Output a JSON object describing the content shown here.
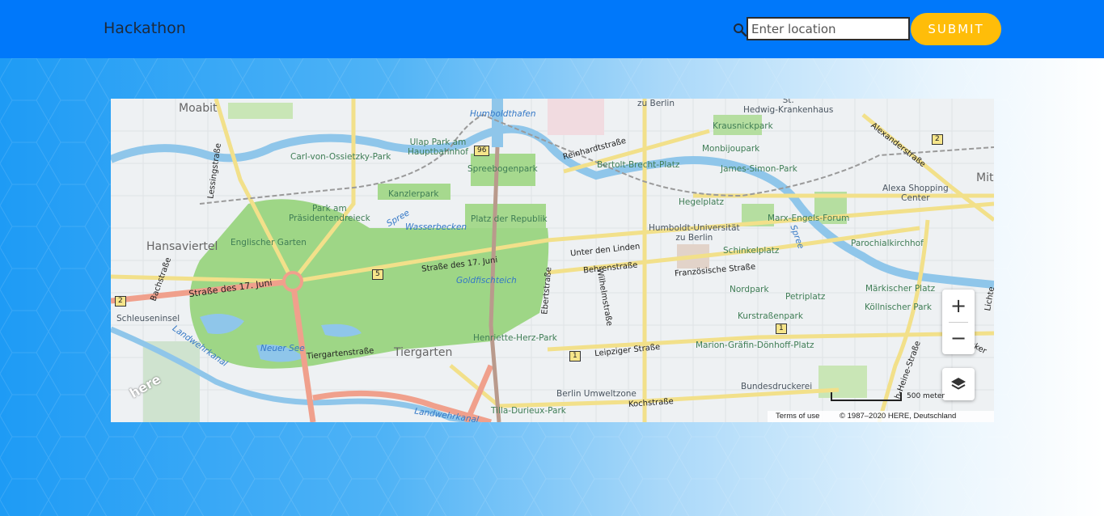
{
  "header": {
    "brand": "Hackathon",
    "search_icon": "search-icon",
    "search_placeholder": "Enter location",
    "search_value": "",
    "submit_label": "SUBMIT"
  },
  "colors": {
    "header_bg": "#0078fa",
    "submit_bg": "#ffbd09",
    "park": "#9ed686",
    "water": "#8fc6ea",
    "main_road": "#f2e08a",
    "highway": "#f0a08c"
  },
  "map": {
    "labels": {
      "moabit": "Moabit",
      "hansaviertel": "Hansaviertel",
      "tiergarten": "Tiergarten",
      "schleuseninsel": "Schleuseninsel",
      "englischer_garten": "Englischer Garten",
      "park_praesidenten": "Park am\nPräsidentendreieck",
      "carl_von_ossietzky": "Carl-von-Ossietzky-Park",
      "ulap_park": "Ulap Park am\nHauptbahnhof",
      "humboldthafen": "Humboldthafen",
      "spreebogenpark": "Spreebogenpark",
      "kanzlerpark": "Kanzlerpark",
      "spree": "Spree",
      "wasserbecken": "Wasserbecken",
      "platz_der_republik": "Platz der Republik",
      "goldfischteich": "Goldfischteich",
      "neuer_see": "Neuer See",
      "henriette_herz_park": "Henriette-Herz-Park",
      "berlin_umweltzone": "Berlin Umweltzone",
      "tilla_durieux_park": "Tilla-Durieux-Park",
      "landwehrkanal": "Landwehrkanal",
      "landwehrkanal2": "Landwehrkanal",
      "zu_berlin": "zu Berlin",
      "hedwig": "St.\nHedwig-Krankenhaus",
      "krausnickpark": "Krausnickpark",
      "monbijoupark": "Monbijoupark",
      "bertolt_brecht": "Bertolt-Brecht-Platz",
      "james_simon": "James-Simon-Park",
      "hegelplatz": "Hegelplatz",
      "humboldt_uni": "Humboldt-Universität\nzu Berlin",
      "marx_engels": "Marx-Engels-Forum",
      "schinkelplatz": "Schinkelplatz",
      "alexa": "Alexa Shopping\nCenter",
      "parochialkirchhof": "Parochialkirchhof",
      "maerkischer_platz": "Märkischer Platz",
      "koellnischer_park": "Köllnischer Park",
      "nordpark": "Nordpark",
      "petriplatz": "Petriplatz",
      "kurstrassenpark": "Kurstraßenpark",
      "marion_graefin": "Marion-Gräfin-Dönhoff-Platz",
      "bundesdruckerei": "Bundesdruckerei",
      "mitte": "Mit",
      "spree2": "Spree",
      "strasse17_west": "Straße des 17. Juni",
      "strasse17_east": "Straße des 17. Juni",
      "tiergartenstrasse": "Tiergartenstraße",
      "reinhardtstrasse": "Reinhardtstraße",
      "unter_den_linden": "Unter den Linden",
      "behrenstrasse": "Behrenstraße",
      "franzoesische": "Französische Straße",
      "leipziger": "Leipziger Straße",
      "kochstrasse": "Kochstraße",
      "wilhelmstrasse": "Wilhelmstraße",
      "ebertstrasse": "Ebertstraße",
      "lessingstrasse": "Lessingstraße",
      "bachstrasse": "Bachstraße",
      "alexanderstrasse": "Alexanderstraße",
      "koepenicker": "Köpenicker",
      "heine_strasse": "h-Heine-Straße",
      "lichten": "Lichte",
      "shield_96": "96",
      "shield_5": "5",
      "shield_2w": "2",
      "shield_2e": "2",
      "shield_1a": "1",
      "shield_1b": "1"
    },
    "controls": {
      "zoom_in": "+",
      "zoom_out": "−",
      "layers_icon": "layers-icon"
    },
    "scale_label": "500 meter",
    "terms": "Terms of use",
    "copyright": "© 1987–2020 HERE, Deutschland",
    "logo": "here"
  }
}
